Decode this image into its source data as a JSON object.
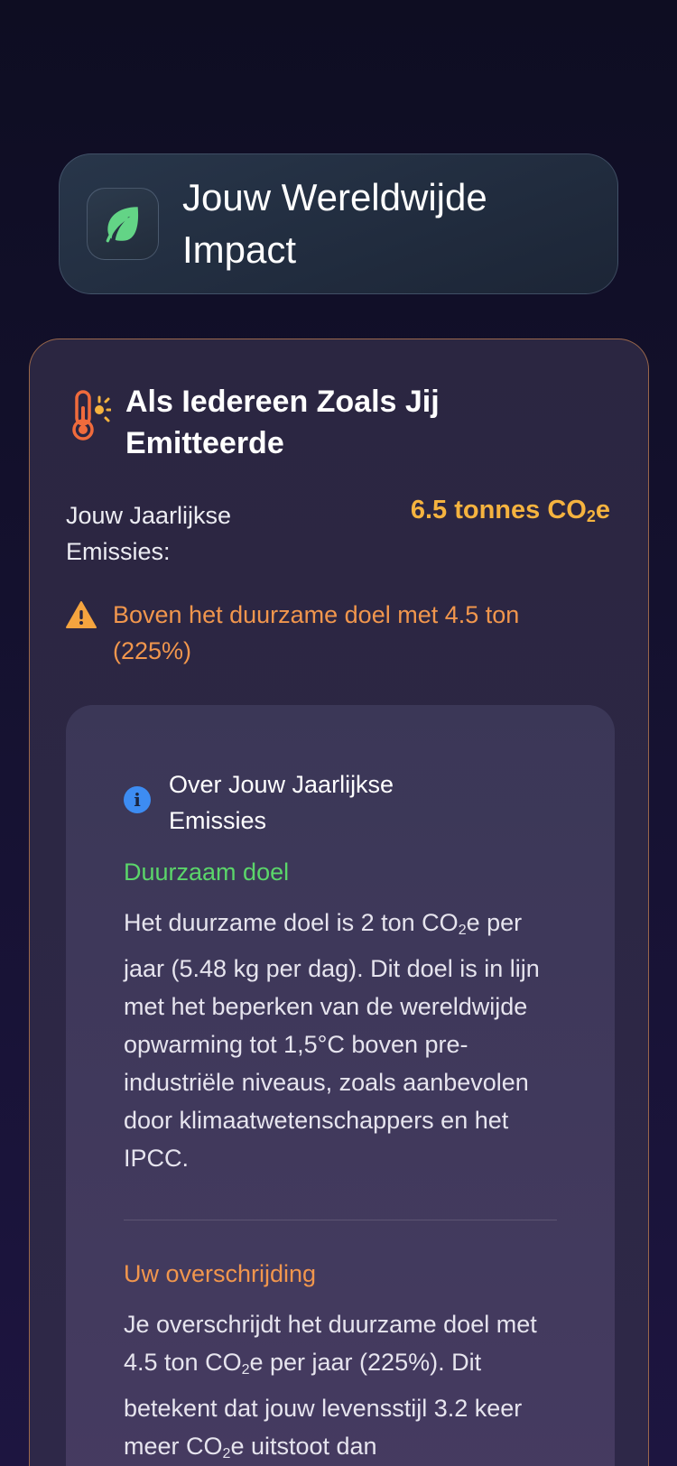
{
  "header": {
    "title": "Jouw Wereldwijde Impact",
    "icon": "leaf-icon"
  },
  "card": {
    "title": "Als Iedereen Zoals Jij Emitteerde",
    "icon": "thermometer-sun-icon",
    "accent_border": "#d68a50",
    "emissions_label": "Jouw Jaarlijkse Emissies:",
    "emissions_value_prefix": "6.5 tonnes CO",
    "emissions_value_sub": "2",
    "emissions_value_suffix": "e",
    "value_color": "#f5b33f",
    "warning_text": "Boven het duurzame doel met 4.5 ton (225%)",
    "warning_color": "#f1964d"
  },
  "info": {
    "icon": "info-icon",
    "title": "Over Jouw Jaarlijkse Emissies",
    "sections": [
      {
        "title": "Duurzaam doel",
        "title_color": "#5bd66a",
        "body_part1": "Het duurzame doel is 2 ton CO",
        "body_sub1": "2",
        "body_part2": "e per jaar (5.48 kg per dag). Dit doel is in lijn met het beperken van de wereldwijde opwarming tot 1,5°C boven pre-industriële niveaus, zoals aanbevolen door klimaatwetenschappers en het IPCC."
      },
      {
        "title": "Uw overschrijding",
        "title_color": "#f1964d",
        "body_part1": "Je overschrijdt het duurzame doel met 4.5 ton CO",
        "body_sub1": "2",
        "body_part2": "e per jaar (225%). Dit betekent dat jouw levensstijl 3.2 keer meer CO",
        "body_sub2": "2",
        "body_part3": "e uitstoot dan"
      }
    ]
  }
}
